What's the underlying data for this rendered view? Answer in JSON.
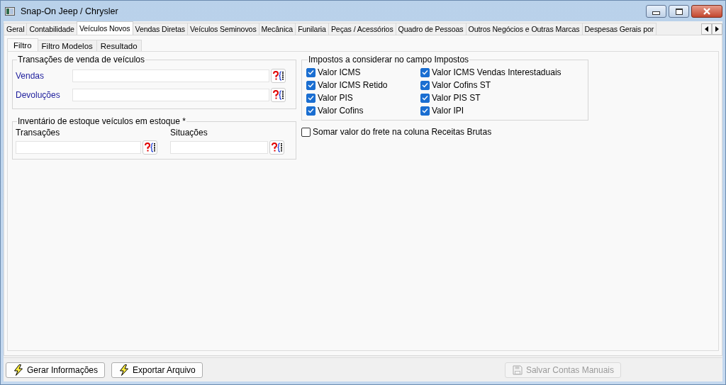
{
  "window": {
    "title": "Snap-On Jeep / Chrysler"
  },
  "tabs": [
    {
      "label": "Geral",
      "selected": false
    },
    {
      "label": "Contabilidade",
      "selected": false
    },
    {
      "label": "Veículos Novos",
      "selected": true
    },
    {
      "label": "Vendas Diretas",
      "selected": false
    },
    {
      "label": "Veículos Seminovos",
      "selected": false
    },
    {
      "label": "Mecânica",
      "selected": false
    },
    {
      "label": "Funilaria",
      "selected": false
    },
    {
      "label": "Peças / Acessórios",
      "selected": false
    },
    {
      "label": "Quadro de Pessoas",
      "selected": false
    },
    {
      "label": "Outros Negócios e Outras Marcas",
      "selected": false
    },
    {
      "label": "Despesas Gerais por",
      "selected": false
    }
  ],
  "subtabs": [
    {
      "label": "Filtro",
      "selected": true
    },
    {
      "label": "Filtro Modelos",
      "selected": false
    },
    {
      "label": "Resultado",
      "selected": false
    }
  ],
  "sales_group": {
    "title": "Transações de venda de veículos",
    "fields": [
      {
        "label": "Vendas"
      },
      {
        "label": "Devoluções"
      }
    ]
  },
  "inventory_group": {
    "title": "Inventário de estoque veículos em estoque *",
    "fields": [
      {
        "label": "Transações"
      },
      {
        "label": "Situações"
      }
    ]
  },
  "taxes_group": {
    "title": "Impostos a considerar no campo Impostos",
    "checkboxes": [
      {
        "label": "Valor ICMS",
        "checked": true
      },
      {
        "label": "Valor ICMS Vendas Interestaduais",
        "checked": true
      },
      {
        "label": "Valor ICMS Retido",
        "checked": true
      },
      {
        "label": "Valor Cofins ST",
        "checked": true
      },
      {
        "label": "Valor PIS",
        "checked": true
      },
      {
        "label": "Valor PIS ST",
        "checked": true
      },
      {
        "label": "Valor Cofins",
        "checked": true
      },
      {
        "label": "Valor IPI",
        "checked": true
      }
    ]
  },
  "freight_option": {
    "label": "Somar valor do frete na coluna Receitas Brutas",
    "checked": false
  },
  "buttons": [
    {
      "label": "Gerar Informações",
      "kind": "lightning",
      "disabled": false
    },
    {
      "label": "Exportar Arquivo",
      "kind": "lightning",
      "disabled": false
    },
    {
      "label": "Salvar Contas Manuais",
      "kind": "save",
      "disabled": true
    }
  ]
}
